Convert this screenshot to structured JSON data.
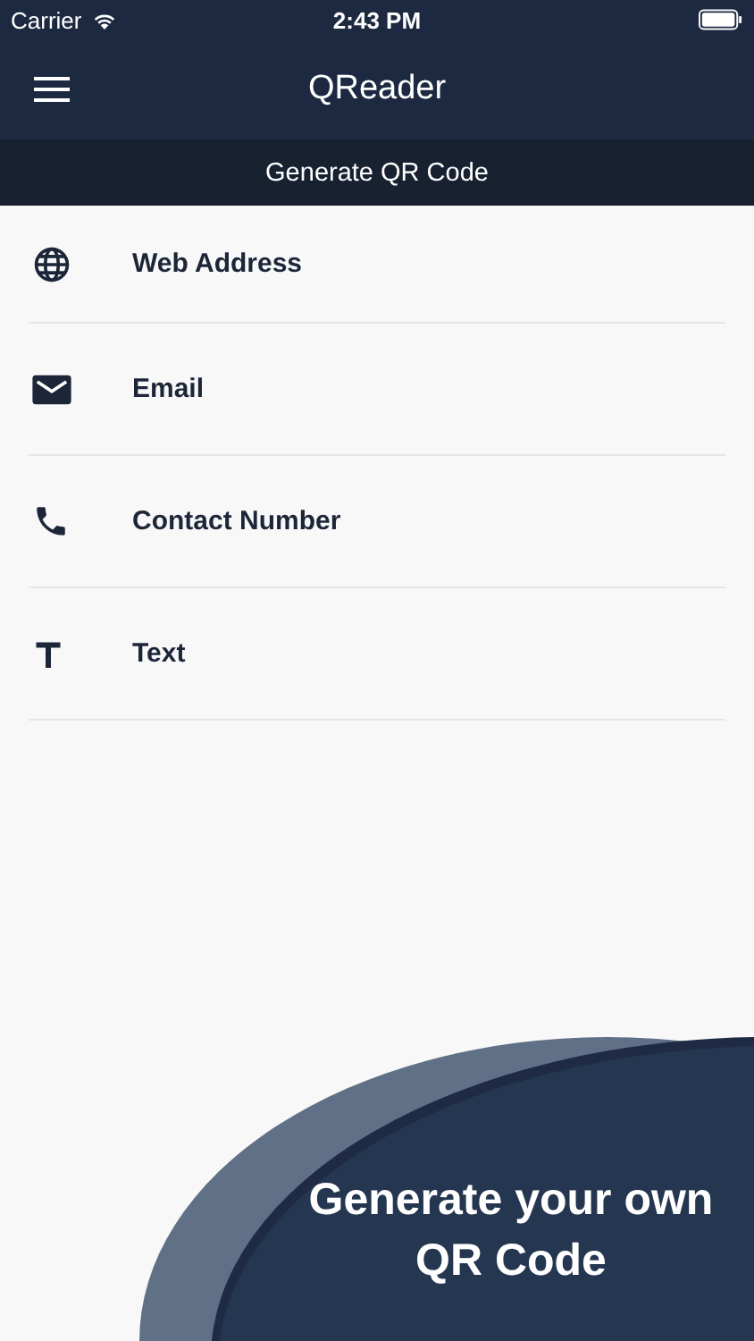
{
  "status_bar": {
    "carrier": "Carrier",
    "time": "2:43 PM"
  },
  "nav_bar": {
    "title": "QReader"
  },
  "section_header": "Generate QR Code",
  "items": [
    {
      "kind": "globe",
      "label": "Web Address"
    },
    {
      "kind": "mail",
      "label": "Email"
    },
    {
      "kind": "phone",
      "label": "Contact Number"
    },
    {
      "kind": "text",
      "label": "Text"
    }
  ],
  "banner": {
    "lines": [
      "Generate your own",
      "QR Code"
    ]
  }
}
